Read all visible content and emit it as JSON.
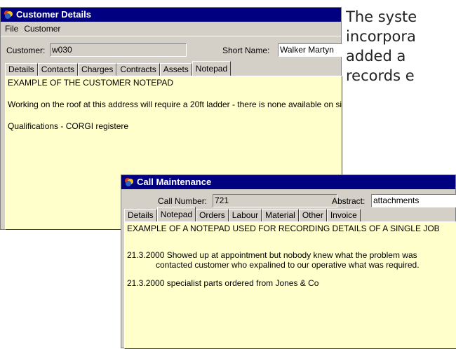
{
  "customer_window": {
    "title": "Customer Details",
    "menu": [
      "File",
      "Customer"
    ],
    "customer_label": "Customer:",
    "customer_value": "w030",
    "short_name_label": "Short Name:",
    "short_name_value": "Walker Martyn",
    "tabs": [
      "Details",
      "Contacts",
      "Charges",
      "Contracts",
      "Assets",
      "Notepad"
    ],
    "active_tab": "Notepad",
    "notes": [
      "EXAMPLE OF THE CUSTOMER NOTEPAD",
      "Working on the roof at this address will require a 20ft ladder - there is none available on site",
      "Qualifications - CORGI registere"
    ]
  },
  "call_window": {
    "title": "Call Maintenance",
    "call_number_label": "Call Number:",
    "call_number_value": "721",
    "abstract_label": "Abstract:",
    "abstract_value": "attachments",
    "tabs": [
      "Details",
      "Notepad",
      "Orders",
      "Labour",
      "Material",
      "Other",
      "Invoice"
    ],
    "active_tab": "Notepad",
    "notes": [
      "EXAMPLE OF A NOTEPAD USED FOR RECORDING DETAILS OF A SINGLE JOB",
      "21.3.2000 Showed up at appointment but nobody knew what the problem was",
      "contacted customer who expalined to our operative what was required.",
      "21.3.2000 specialist parts ordered from Jones & Co"
    ]
  },
  "side_text": [
    "The syste",
    "incorpora",
    "added a",
    "records e"
  ],
  "colors": {
    "titlebar": "#000080",
    "window_face": "#d4d0c8",
    "notepad": "#ffffcc"
  },
  "icons": {
    "app": "app-logo-icon"
  }
}
